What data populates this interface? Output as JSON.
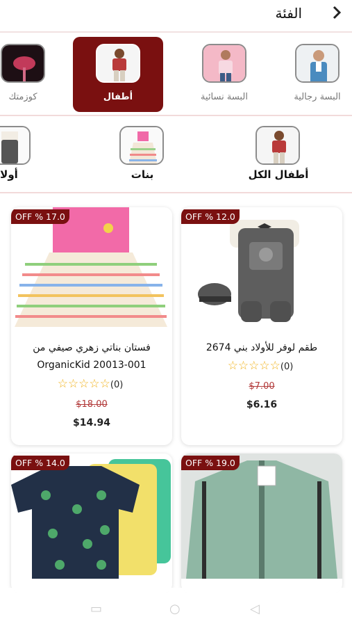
{
  "header": {
    "back_icon": "chevron-right",
    "title": "الفئة"
  },
  "categories": [
    {
      "label": "البسة رجالية",
      "icon": "men-clothing",
      "active": false
    },
    {
      "label": "البسة نسائية",
      "icon": "women-clothing",
      "active": false
    },
    {
      "label": "أطفال",
      "icon": "kids-clothing",
      "active": true
    },
    {
      "label": "كوزمتك",
      "icon": "cosmetics",
      "active": false
    }
  ],
  "subcategories": [
    {
      "label": "أطفال الكل",
      "icon": "kids-all"
    },
    {
      "label": "بنات",
      "icon": "girls"
    },
    {
      "label": "أولا",
      "icon": "boys"
    }
  ],
  "products": [
    {
      "badge": "OFF % 12.0",
      "name": "طقم لوفر للأولاد بني 2674",
      "rating_count": "(0)",
      "old_price": "$7.00",
      "new_price": "$6.16"
    },
    {
      "badge": "OFF % 17.0",
      "name": "فستان بناتي زهري صيفي من OrganicKid 20013-001",
      "rating_count": "(0)",
      "old_price": "$18.00",
      "new_price": "$14.94"
    },
    {
      "badge": "OFF % 19.0"
    },
    {
      "badge": "OFF % 14.0"
    }
  ],
  "colors": {
    "accent": "#7a1010",
    "star": "#f0b015",
    "old_price": "#b23a3a"
  }
}
